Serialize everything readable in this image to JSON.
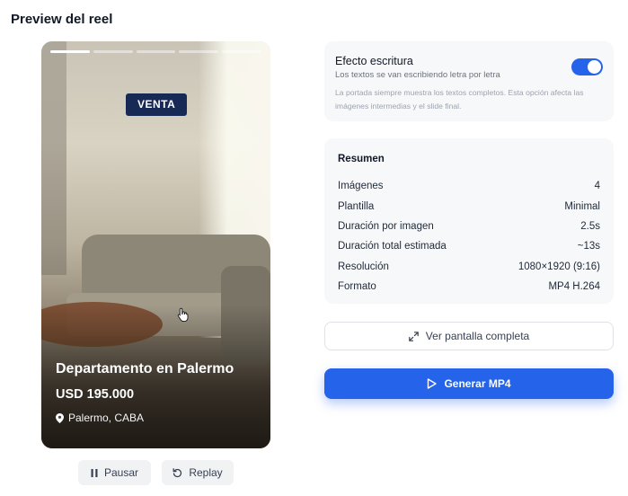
{
  "page": {
    "title": "Preview del reel"
  },
  "reel": {
    "progress_segments": 5,
    "active_segment": 1,
    "badge": "VENTA",
    "listing_title": "Departamento en Palermo",
    "price": "USD 195.000",
    "location": "Palermo, CABA"
  },
  "controls": {
    "pause_label": "Pausar",
    "replay_label": "Replay"
  },
  "effect": {
    "title": "Efecto escritura",
    "subtitle": "Los textos se van escribiendo letra por letra",
    "note": "La portada siempre muestra los textos completos. Esta opción afecta las imágenes intermedias y el slide final.",
    "enabled": true
  },
  "summary": {
    "title": "Resumen",
    "rows": [
      {
        "label": "Imágenes",
        "value": "4"
      },
      {
        "label": "Plantilla",
        "value": "Minimal"
      },
      {
        "label": "Duración por imagen",
        "value": "2.5s"
      },
      {
        "label": "Duración total estimada",
        "value": "~13s"
      },
      {
        "label": "Resolución",
        "value": "1080×1920 (9:16)"
      },
      {
        "label": "Formato",
        "value": "MP4 H.264"
      }
    ]
  },
  "actions": {
    "fullscreen_label": "Ver pantalla completa",
    "generate_label": "Generar MP4"
  },
  "colors": {
    "accent": "#2563eb",
    "badge_bg": "#172a55"
  },
  "icons": {
    "pause": "pause-icon",
    "replay": "replay-icon",
    "pin": "pin-icon",
    "expand": "expand-icon",
    "play": "play-icon",
    "cursor": "hand-cursor-icon"
  }
}
